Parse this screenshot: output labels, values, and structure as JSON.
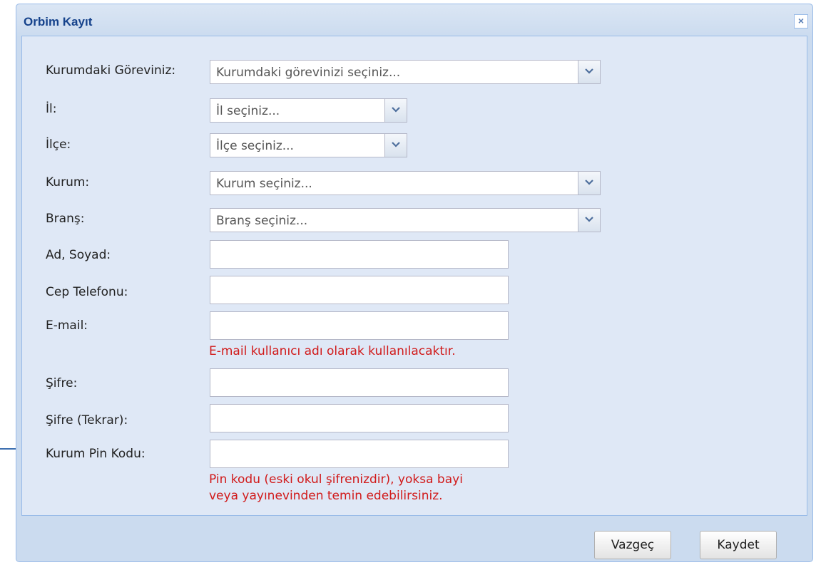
{
  "window": {
    "title": "Orbim Kayıt",
    "close_label": "×"
  },
  "form": {
    "gorev": {
      "label": "Kurumdaki Göreviniz:",
      "placeholder": "Kurumdaki görevinizi seçiniz..."
    },
    "il": {
      "label": "İl:",
      "placeholder": "İl seçiniz..."
    },
    "ilce": {
      "label": "İlçe:",
      "placeholder": "İlçe seçiniz..."
    },
    "kurum": {
      "label": "Kurum:",
      "placeholder": "Kurum seçiniz..."
    },
    "brans": {
      "label": "Branş:",
      "placeholder": "Branş seçiniz..."
    },
    "ad_soyad": {
      "label": "Ad, Soyad:",
      "value": ""
    },
    "cep_telefonu": {
      "label": "Cep Telefonu:",
      "value": ""
    },
    "email": {
      "label": "E-mail:",
      "value": "",
      "hint": "E-mail kullanıcı adı olarak kullanılacaktır."
    },
    "sifre": {
      "label": "Şifre:",
      "value": ""
    },
    "sifre_tekrar": {
      "label": "Şifre (Tekrar):",
      "value": ""
    },
    "pin_kodu": {
      "label": "Kurum Pin Kodu:",
      "value": "",
      "hint_line1": "Pin kodu (eski okul şifrenizdir), yoksa bayi",
      "hint_line2": "veya yayınevinden temin edebilirsiniz."
    }
  },
  "footer": {
    "cancel_label": "Vazgeç",
    "save_label": "Kaydet"
  },
  "colors": {
    "title_text": "#15428b",
    "panel_bg": "#dfe8f6",
    "window_bg": "#cbdbef",
    "hint_text": "#d11a1a"
  }
}
